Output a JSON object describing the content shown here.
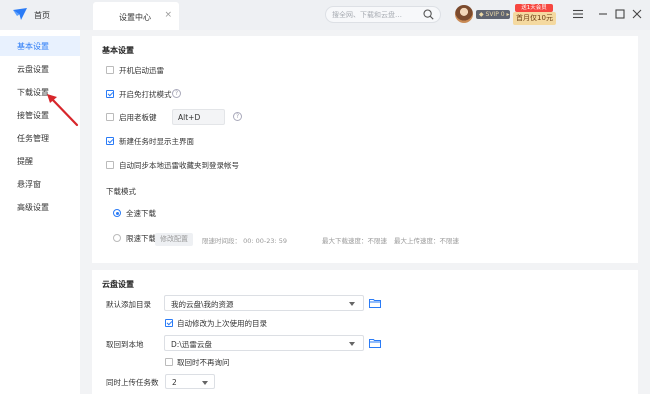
{
  "titlebar": {
    "home_label": "首页",
    "active_tab": "设置中心",
    "tab_close": "×",
    "search_placeholder": "搜全网、下载和云盘…",
    "vip_badge": "◆ SVIP 0 ▸",
    "promo_tag": "送1天会员",
    "promo_label": "首月仅10元"
  },
  "sidebar": {
    "items": [
      {
        "label": "基本设置",
        "active": true
      },
      {
        "label": "云盘设置"
      },
      {
        "label": "下载设置"
      },
      {
        "label": "接管设置"
      },
      {
        "label": "任务管理"
      },
      {
        "label": "提醒"
      },
      {
        "label": "悬浮窗"
      },
      {
        "label": "高级设置"
      }
    ]
  },
  "basic": {
    "title": "基本设置",
    "options": [
      {
        "label": "开机启动迅雷",
        "checked": false
      },
      {
        "label": "开启免打扰模式",
        "checked": true
      },
      {
        "label": "启用老板键",
        "checked": false
      },
      {
        "label": "新建任务时显示主界面",
        "checked": true
      },
      {
        "label": "自动同步本地迅雷收藏夹到登录帐号",
        "checked": false
      }
    ],
    "help_glyph": "?",
    "hotkey_value": "Alt+D",
    "download_mode": {
      "title": "下载模式",
      "full_speed": "全速下载",
      "limited": "限速下载",
      "modify_button": "修改配置",
      "limit_time": "限速时间段：  00: 00-23: 59",
      "max_download": "最大下载速度：不限速",
      "max_upload": "最大上传速度：不限速"
    }
  },
  "cloud": {
    "title": "云盘设置",
    "default_dir_label": "默认添加目录",
    "default_dir_value": "我的云盘\\我的资源",
    "auto_modify_label": "自动修改为上次使用的目录",
    "auto_modify_checked": true,
    "fetch_local_label": "取回到本地",
    "fetch_local_value": "D:\\迅雷云盘",
    "no_ask_label": "取回时不再询问",
    "no_ask_checked": false,
    "concurrent_label": "同时上传任务数",
    "concurrent_value": "2"
  },
  "colors": {
    "accent": "#2a7bf6",
    "annotation_arrow": "#d7262b"
  }
}
